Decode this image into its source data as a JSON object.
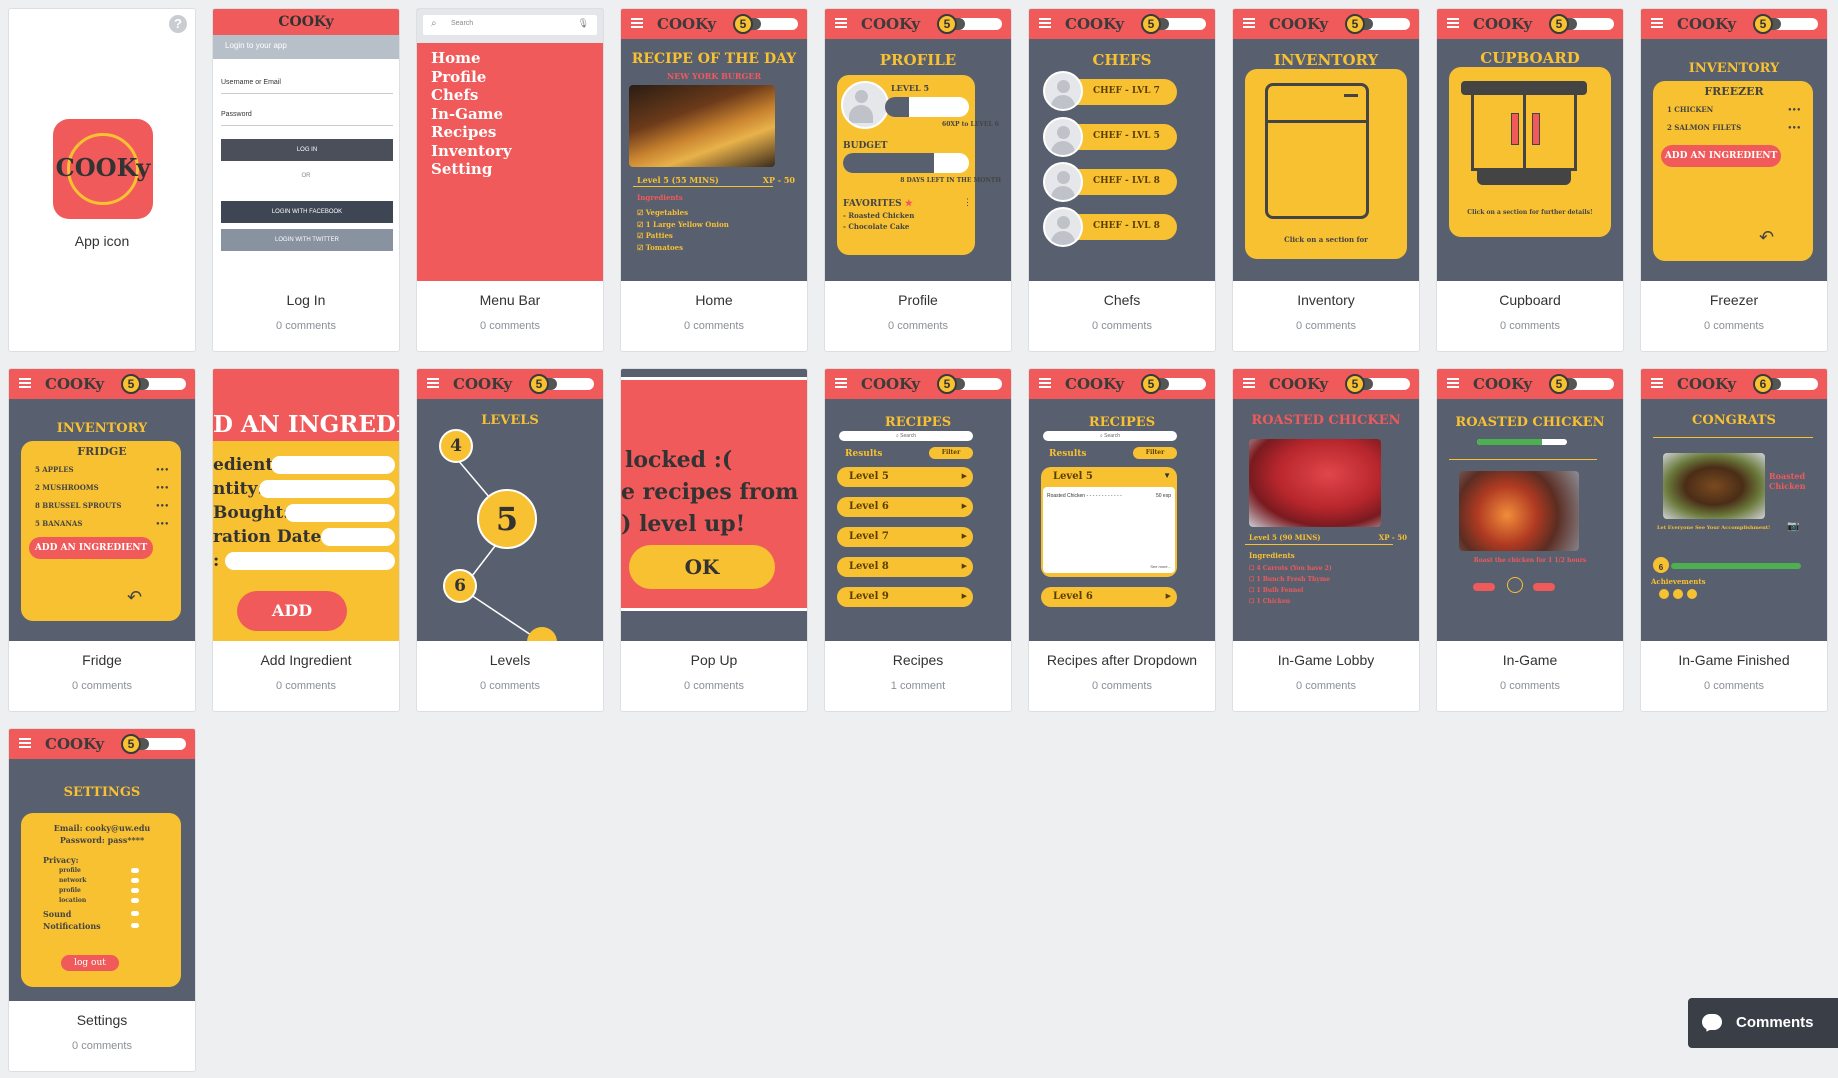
{
  "app": {
    "brand": "COOKy",
    "level": "5",
    "level_finished": "6"
  },
  "cards": [
    {
      "title": "App icon",
      "comments": ""
    },
    {
      "title": "Log In",
      "comments": "0 comments"
    },
    {
      "title": "Menu Bar",
      "comments": "0 comments"
    },
    {
      "title": "Home",
      "comments": "0 comments"
    },
    {
      "title": "Profile",
      "comments": "0 comments"
    },
    {
      "title": "Chefs",
      "comments": "0 comments"
    },
    {
      "title": "Inventory",
      "comments": "0 comments"
    },
    {
      "title": "Cupboard",
      "comments": "0 comments"
    },
    {
      "title": "Freezer",
      "comments": "0 comments"
    },
    {
      "title": "Fridge",
      "comments": "0 comments"
    },
    {
      "title": "Add Ingredient",
      "comments": "0 comments"
    },
    {
      "title": "Levels",
      "comments": "0 comments"
    },
    {
      "title": "Pop Up",
      "comments": "0 comments"
    },
    {
      "title": "Recipes",
      "comments": "1 comment"
    },
    {
      "title": "Recipes after Dropdown",
      "comments": "0 comments"
    },
    {
      "title": "In-Game Lobby",
      "comments": "0 comments"
    },
    {
      "title": "In-Game",
      "comments": "0 comments"
    },
    {
      "title": "In-Game Finished",
      "comments": "0 comments"
    },
    {
      "title": "Settings",
      "comments": "0 comments"
    }
  ],
  "login": {
    "header": "Login to your app",
    "username": "Username or Email",
    "password": "Password",
    "login_btn": "LOG IN",
    "or": "OR",
    "facebook": "LOGIN WITH FACEBOOK",
    "twitter": "LOGIN WITH TWITTER"
  },
  "menu": {
    "search": "Search",
    "items": [
      "Home",
      "Profile",
      "Chefs",
      "In-Game",
      "Recipes",
      "Inventory",
      "Setting"
    ]
  },
  "home": {
    "title": "RECIPE OF THE DAY",
    "subtitle": "NEW YORK BURGER",
    "level": "Level 5 (55 MINS)",
    "xp": "XP - 50",
    "ingredients_label": "Ingredients",
    "ingredients": [
      "Vegetables",
      "1 Large Yellow Onion",
      "Patties",
      "Tomatoes"
    ]
  },
  "profile": {
    "title": "PROFILE",
    "level": "LEVEL 5",
    "xp_note": "60XP to LEVEL 6",
    "budget": "BUDGET",
    "budget_note": "8 DAYS LEFT IN THE MONTH",
    "favorites": "FAVORITES",
    "fav_items": [
      "- Roasted Chicken",
      "- Chocolate Cake"
    ]
  },
  "chefs": {
    "title": "CHEFS",
    "items": [
      "CHEF - LVL 7",
      "CHEF - LVL 5",
      "CHEF - LVL 8",
      "CHEF - LVL 8"
    ]
  },
  "inventory": {
    "title": "INVENTORY",
    "hint": "Click on a section for"
  },
  "cupboard": {
    "title": "CUPBOARD",
    "hint": "Click on a section for further details!"
  },
  "freezer": {
    "title": "INVENTORY",
    "subtitle": "FREEZER",
    "items": [
      "1 CHICKEN",
      "2 SALMON FILETS"
    ],
    "add": "ADD AN INGREDIENT"
  },
  "fridge": {
    "title": "INVENTORY",
    "subtitle": "FRIDGE",
    "items": [
      "5 APPLES",
      "2 MUSHROOMS",
      "8 BRUSSEL SPROUTS",
      "5 BANANAS"
    ],
    "add": "ADD AN INGREDIENT"
  },
  "add_ingredient": {
    "title": "D AN INGREDIEI",
    "fields": [
      "edient:",
      "ntity:",
      "Bought:",
      "ration Date:",
      ":"
    ],
    "add": "ADD"
  },
  "levels": {
    "title": "LEVELS",
    "nodes": [
      "4",
      "5",
      "6"
    ]
  },
  "popup": {
    "lines": [
      "locked :(",
      "e recipes from",
      ") level up!"
    ],
    "ok": "OK"
  },
  "recipes": {
    "title": "RECIPES",
    "search": "Search",
    "results": "Results",
    "filter": "Filter",
    "levels": [
      "Level 5",
      "Level 6",
      "Level 7",
      "Level 8",
      "Level 9"
    ],
    "dropdown_row": "Roasted Chicken",
    "dropdown_exp": "50 exp",
    "see_more": "See more..."
  },
  "lobby": {
    "title": "ROASTED CHICKEN",
    "level": "Level 5 (90 MINS)",
    "xp": "XP - 50",
    "ingredients_label": "Ingredients",
    "ingredients": [
      "4 Carrots (You have 2)",
      "1 Bunch Fresh Thyme",
      "1 Bulb Fennel",
      "1 Chicken"
    ]
  },
  "ingame": {
    "title": "ROASTED CHICKEN",
    "step": "Roast the chicken for 1 1/2 hours"
  },
  "finished": {
    "title": "CONGRATS",
    "dish": "Roasted Chicken",
    "share": "Let Everyone See Your Accomplishment!",
    "achievements": "Achievements",
    "level": "6"
  },
  "settings": {
    "title": "SETTINGS",
    "email": "Email: cooky@uw.edu",
    "password": "Password: pass****",
    "privacy": "Privacy:",
    "options": [
      "profile",
      "network",
      "profile",
      "location"
    ],
    "sound": "Sound",
    "notifications": "Notifications",
    "logout": "log out"
  },
  "comments_button": "Comments"
}
